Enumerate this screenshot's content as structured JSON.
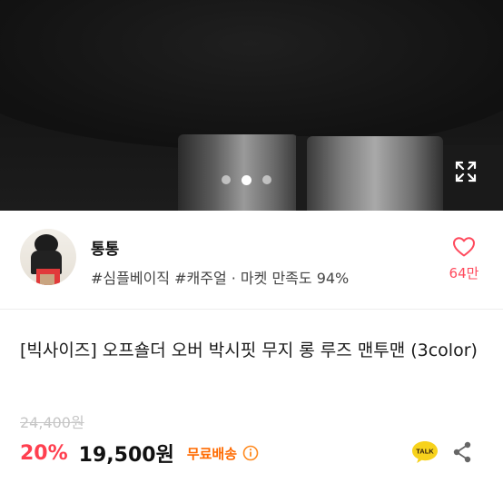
{
  "gallery": {
    "slide_count": 3,
    "active_slide": 2
  },
  "seller": {
    "name": "통통",
    "tags": "#심플베이직 #캐주얼 · 마켓 만족도 94%",
    "like_count": "64만"
  },
  "product": {
    "title": "[빅사이즈] 오프숄더 오버 박시핏 무지 롱 루즈 맨투맨 (3color)",
    "original_price": "24,400원",
    "discount": "20%",
    "price": "19,500원",
    "shipping": "무료배송",
    "talk_label": "TALK"
  },
  "colors": {
    "accent_red": "#ff3f4f",
    "shipping_orange": "#ff6a00",
    "talk_yellow": "#f7d21c"
  },
  "icons": [
    "expand-icon",
    "heart-icon",
    "info-icon",
    "talk-icon",
    "share-icon"
  ]
}
